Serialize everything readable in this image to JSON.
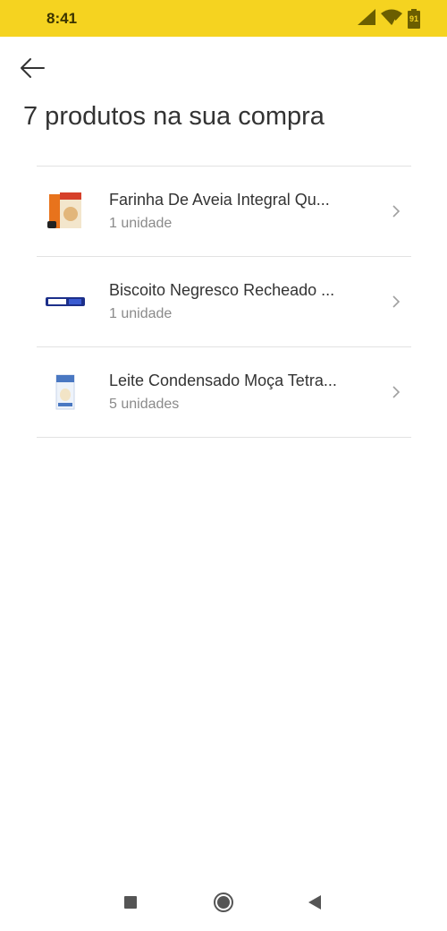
{
  "status_bar": {
    "time": "8:41",
    "battery_level": "91",
    "icons": [
      "signal-icon",
      "wifi-icon",
      "battery-icon"
    ],
    "background": "#f5d320"
  },
  "header": {
    "back_icon": "arrow-left-icon",
    "title": "7 produtos na sua compra"
  },
  "products": [
    {
      "name": "Farinha De Aveia Integral Qu...",
      "quantity": "1 unidade",
      "thumb": "oat-flour-box"
    },
    {
      "name": "Biscoito Negresco Recheado ...",
      "quantity": "1 unidade",
      "thumb": "negresco-biscuit-pack"
    },
    {
      "name": "Leite Condensado Moça Tetra...",
      "quantity": "5 unidades",
      "thumb": "condensed-milk-carton"
    }
  ],
  "nav_bar": {
    "icons": [
      "recent-apps-icon",
      "home-icon",
      "back-triangle-icon"
    ]
  }
}
